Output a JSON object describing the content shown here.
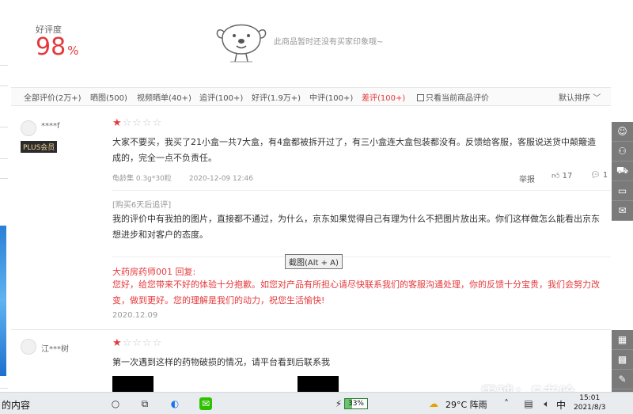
{
  "summary": {
    "rate_label": "好评度",
    "rate_value": "98",
    "rate_unit": "%",
    "no_impression": "此商品暂时还没有买家印象哦~"
  },
  "filters": [
    {
      "label": "全部评价(2万+)",
      "active": false
    },
    {
      "label": "晒图(500)",
      "active": false
    },
    {
      "label": "视频晒单(40+)",
      "active": false
    },
    {
      "label": "追评(100+)",
      "active": false
    },
    {
      "label": "好评(1.9万+)",
      "active": false
    },
    {
      "label": "中评(100+)",
      "active": false
    },
    {
      "label": "差评(100+)",
      "active": true
    }
  ],
  "current_only": "只看当前商品评价",
  "sort_label": "默认排序",
  "reviews": [
    {
      "user": "****f",
      "badge": "PLUS会员",
      "stars": 1,
      "content": "大家不要买，我买了21小盒一共7大盒，有4盒都被拆开过了，有三小盒连大盒包装都没有。反馈给客服，客服说送货中颠簸造成的，完全一点不负责任。",
      "product": "龟龄集 0.3g*30粒",
      "date": "2020-12-09 12:46",
      "report": "举报",
      "likes": "17",
      "comments": "1",
      "addition_label": "[购买6天后追评]",
      "addition": "我的评价中有我拍的图片，直接都不通过，为什么，京东如果觉得自己有理为什么不把图片放出来。你们这样做怎么能看出京东想进步和对客户的态度。",
      "reply_who": "大药房药师001 回复:",
      "reply": "您好，给您带来不好的体验十分抱歉。如您对产品有所担心请尽快联系我们的客服沟通处理，你的反馈十分宝贵，我们会努力改变，做到更好。您的理解是我们的动力，祝您生活愉快!",
      "reply_date": "2020.12.09"
    },
    {
      "user": "江***树",
      "stars": 1,
      "content": "第一次遇到这样的药物破损的情况，请平台看到后联系我"
    }
  ],
  "tooltip": "截图(Alt + A)",
  "watermark": "雪球：F老哈",
  "taskbar": {
    "left_text": "的内容",
    "battery": "33%",
    "weather": "29°C 阵雨",
    "ime": "中",
    "time": "15:01",
    "date": "2021/8/3"
  }
}
